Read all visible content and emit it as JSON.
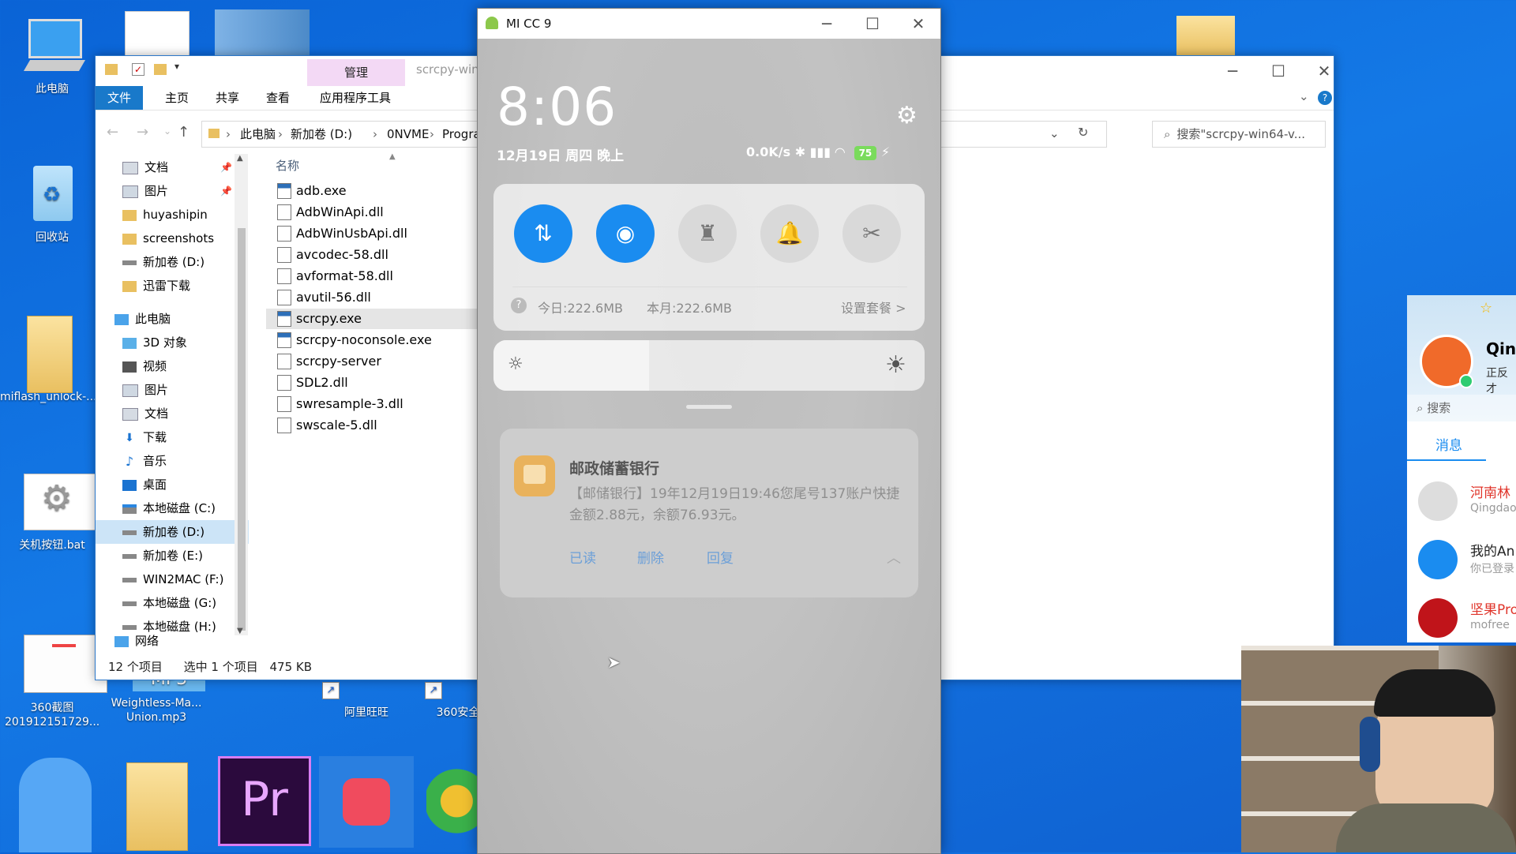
{
  "desktop": {
    "icons": [
      {
        "label": "此电脑"
      },
      {
        "label": "回收站"
      },
      {
        "label": "miflash_unlock-..."
      },
      {
        "label": "关机按钮.bat"
      },
      {
        "label": "360截图\n201912151729..."
      },
      {
        "label": "Weightless-Ma...\nUnion.mp3",
        "badge": "MP3"
      },
      {
        "label": "阿里旺旺"
      },
      {
        "label": "360安全"
      }
    ],
    "taskbar_apps": [
      {
        "name": "premiere-pro",
        "glyph": "Pr"
      }
    ]
  },
  "explorer": {
    "title_partial": "scrcpy-win",
    "ribbon_context": "管理",
    "tabs": [
      "文件",
      "主页",
      "共享",
      "查看",
      "应用程序工具"
    ],
    "breadcrumb": [
      "此电脑",
      "新加卷 (D:)",
      "0NVME",
      "Progra"
    ],
    "search_placeholder": "搜索\"scrcpy-win64-v...",
    "column_name": "名称",
    "nav": [
      {
        "label": "文档",
        "pinned": true
      },
      {
        "label": "图片",
        "pinned": true
      },
      {
        "label": "huyashipin"
      },
      {
        "label": "screenshots"
      },
      {
        "label": "新加卷 (D:)"
      },
      {
        "label": "迅雷下载"
      },
      {
        "label": "此电脑"
      },
      {
        "label": "3D 对象"
      },
      {
        "label": "视频"
      },
      {
        "label": "图片"
      },
      {
        "label": "文档"
      },
      {
        "label": "下载"
      },
      {
        "label": "音乐"
      },
      {
        "label": "桌面"
      },
      {
        "label": "本地磁盘 (C:)"
      },
      {
        "label": "新加卷 (D:)",
        "selected": true
      },
      {
        "label": "新加卷 (E:)"
      },
      {
        "label": "WIN2MAC (F:)"
      },
      {
        "label": "本地磁盘 (G:)"
      },
      {
        "label": "本地磁盘 (H:)"
      },
      {
        "label": "网络"
      }
    ],
    "files": [
      {
        "name": "adb.exe",
        "type": "exe"
      },
      {
        "name": "AdbWinApi.dll",
        "type": "dll"
      },
      {
        "name": "AdbWinUsbApi.dll",
        "type": "dll"
      },
      {
        "name": "avcodec-58.dll",
        "type": "dll"
      },
      {
        "name": "avformat-58.dll",
        "type": "dll"
      },
      {
        "name": "avutil-56.dll",
        "type": "dll"
      },
      {
        "name": "scrcpy.exe",
        "type": "exe",
        "selected": true
      },
      {
        "name": "scrcpy-noconsole.exe",
        "type": "exe"
      },
      {
        "name": "scrcpy-server",
        "type": "file"
      },
      {
        "name": "SDL2.dll",
        "type": "dll"
      },
      {
        "name": "swresample-3.dll",
        "type": "dll"
      },
      {
        "name": "swscale-5.dll",
        "type": "dll"
      }
    ],
    "status": {
      "count": "12 个项目",
      "selection": "选中 1 个项目",
      "size": "475 KB"
    }
  },
  "phone": {
    "window_title": "MI CC 9",
    "clock": "8:06",
    "date": "12月19日 周四 晚上",
    "net_speed": "0.0K/s",
    "battery": "75",
    "usage_today": "今日:222.6MB",
    "usage_month": "本月:222.6MB",
    "plan_link": "设置套餐 >",
    "brightness_level": 0.36,
    "toggles": [
      {
        "name": "mobile-data",
        "on": true
      },
      {
        "name": "wifi",
        "on": true
      },
      {
        "name": "flashlight",
        "on": false
      },
      {
        "name": "sound",
        "on": false
      },
      {
        "name": "screenshot",
        "on": false
      }
    ],
    "notification": {
      "app": "邮政储蓄银行",
      "body": "【邮储银行】19年12月19日19:46您尾号137账户快捷金额2.88元，余额76.93元。",
      "actions": [
        "已读",
        "删除",
        "回复"
      ]
    }
  },
  "chat": {
    "name_partial": "Qin",
    "subtitle_partial": "正反才",
    "search": "搜索",
    "tab": "消息",
    "items": [
      {
        "title": "河南林",
        "sub": "Qingdao",
        "title_color": "#e0352b"
      },
      {
        "title": "我的An",
        "sub": "你已登录",
        "title_color": "#222222"
      },
      {
        "title": "坚果Pro",
        "sub": "mofree",
        "title_color": "#e0352b"
      }
    ]
  }
}
